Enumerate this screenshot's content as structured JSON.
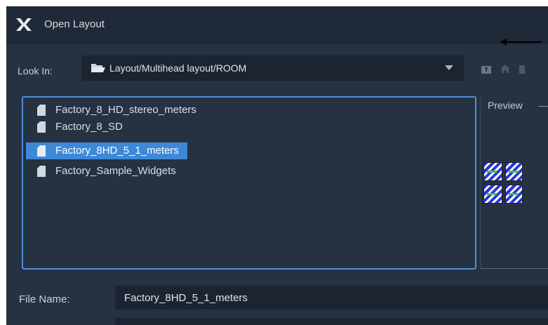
{
  "window": {
    "title": "Open Layout",
    "logo_icon": "x-logo-icon"
  },
  "look_in": {
    "label": "Look In:",
    "path": "Layout/Multihead layout/ROOM",
    "folder_icon": "folder-open-icon",
    "dropdown_icon": "triangle-down-icon"
  },
  "toolbar": {
    "icons": [
      "folder-up-icon",
      "home-icon",
      "more-icon"
    ]
  },
  "files": {
    "items": [
      {
        "label": "Factory_8_HD_stereo_meters",
        "selected": false
      },
      {
        "label": "Factory_8_SD",
        "selected": false
      },
      {
        "label": "Factory_8HD_5_1_meters",
        "selected": true
      },
      {
        "label": "Factory_Sample_Widgets",
        "selected": false
      }
    ]
  },
  "preview": {
    "label": "Preview"
  },
  "file_name": {
    "label": "File Name:",
    "value": "Factory_8HD_5_1_meters"
  },
  "colors": {
    "dialog_bg": "#263241",
    "field_bg": "#1b2430",
    "selection": "#3e88d8",
    "list_border": "#4d8fd6"
  }
}
